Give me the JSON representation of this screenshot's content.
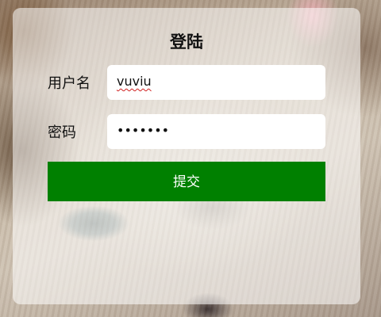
{
  "login_form": {
    "title": "登陆",
    "username": {
      "label": "用户名",
      "value": "vuviu"
    },
    "password": {
      "label": "密码",
      "masked_value": "•••••••"
    },
    "submit_label": "提交",
    "colors": {
      "submit_background": "#008000",
      "submit_text": "#ffffff",
      "card_background": "rgba(255,255,255,0.55)"
    }
  },
  "background": {
    "subject": "cat-photo"
  }
}
